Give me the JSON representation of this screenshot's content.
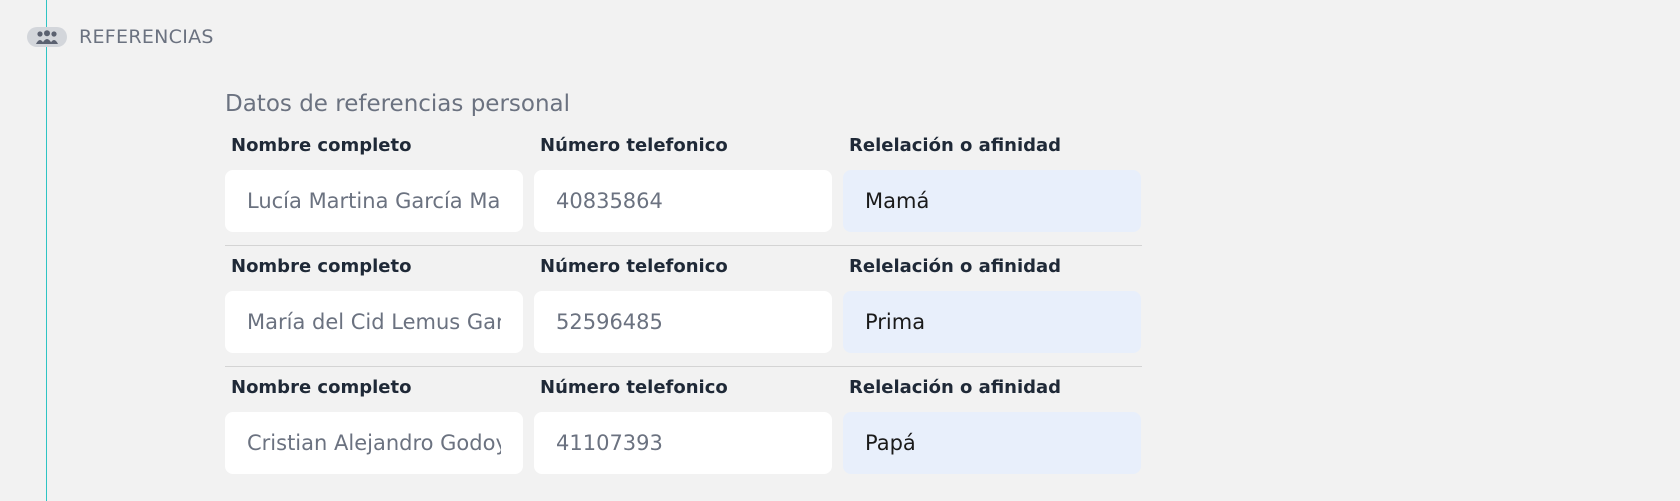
{
  "section": {
    "icon": "people-group-icon",
    "title": "REFERENCIAS"
  },
  "subtitle": "Datos de referencias personal",
  "colors": {
    "timeline": "#2ec4c4",
    "background": "#f2f2f2",
    "select_bg": "#e8effb"
  },
  "references": [
    {
      "name_label": "Nombre completo",
      "name_value": "Lucía Martina García Mar",
      "phone_label": "Número telefonico",
      "phone_value": "40835864",
      "relation_label": "Relelación o afinidad",
      "relation_value": "Mamá"
    },
    {
      "name_label": "Nombre completo",
      "name_value": "María del Cid Lemus Gar",
      "phone_label": "Número telefonico",
      "phone_value": "52596485",
      "relation_label": "Relelación o afinidad",
      "relation_value": "Prima"
    },
    {
      "name_label": "Nombre completo",
      "name_value": "Cristian Alejandro Godoy",
      "phone_label": "Número telefonico",
      "phone_value": "41107393",
      "relation_label": "Relelación o afinidad",
      "relation_value": "Papá"
    }
  ]
}
